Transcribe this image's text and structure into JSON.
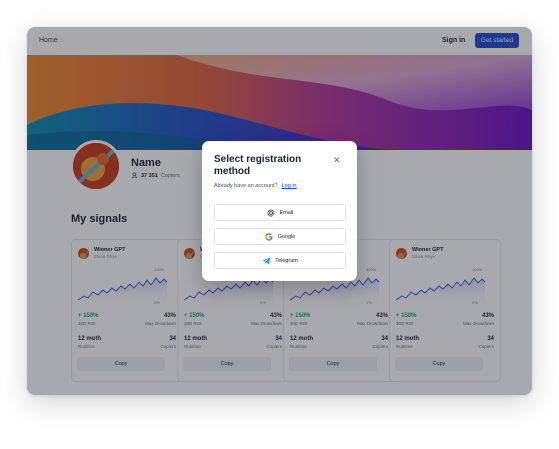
{
  "nav": {
    "home": "Home",
    "sign_in": "Sign in",
    "cta": "Get started"
  },
  "profile": {
    "name": "Name",
    "copiers_count": "37 351",
    "copiers_label": "Copiers"
  },
  "section_title": "My signals",
  "cards": [
    {
      "name": "Winner GPT",
      "author": "Olivia Rhye",
      "pct_max": "100%",
      "pct_min": "0%",
      "roi": "+ 150%",
      "roi_label": "30D ROI",
      "drawdown": "43%",
      "drawdown_label": "Max Drowdown",
      "runtime": "12 moth",
      "runtime_label": "Runtime",
      "copiers": "34",
      "copiers_label": "Copiers",
      "button": "Copy"
    },
    {
      "name": "Winner GPT",
      "author": "Olivia Rhye",
      "pct_max": "100%",
      "pct_min": "0%",
      "roi": "+ 150%",
      "roi_label": "30D ROI",
      "drawdown": "43%",
      "drawdown_label": "Max Drowdown",
      "runtime": "12 moth",
      "runtime_label": "Runtime",
      "copiers": "34",
      "copiers_label": "Copiers",
      "button": "Copy"
    },
    {
      "name": "Winner GPT",
      "author": "Olivia Rhye",
      "pct_max": "100%",
      "pct_min": "0%",
      "roi": "+ 150%",
      "roi_label": "30D ROI",
      "drawdown": "43%",
      "drawdown_label": "Max Drowdown",
      "runtime": "12 moth",
      "runtime_label": "Runtime",
      "copiers": "34",
      "copiers_label": "Copiers",
      "button": "Copy"
    },
    {
      "name": "Winner GPT",
      "author": "Olivia Rhye",
      "pct_max": "100%",
      "pct_min": "0%",
      "roi": "+ 150%",
      "roi_label": "30D ROI",
      "drawdown": "43%",
      "drawdown_label": "Max Drowdown",
      "runtime": "12 moth",
      "runtime_label": "Runtime",
      "copiers": "34",
      "copiers_label": "Copiers",
      "button": "Copy"
    }
  ],
  "modal": {
    "title": "Select registration method",
    "close_icon": "close-icon",
    "subtitle": "Already have an account?",
    "login_link": "Log in",
    "options": [
      {
        "label": "Email",
        "icon": "at-icon"
      },
      {
        "label": "Google",
        "icon": "google-icon"
      },
      {
        "label": "Telegram",
        "icon": "telegram-icon"
      }
    ]
  },
  "colors": {
    "primary": "#2049d8",
    "positive": "#15a05a",
    "chart_line": "#3a4fd6"
  }
}
